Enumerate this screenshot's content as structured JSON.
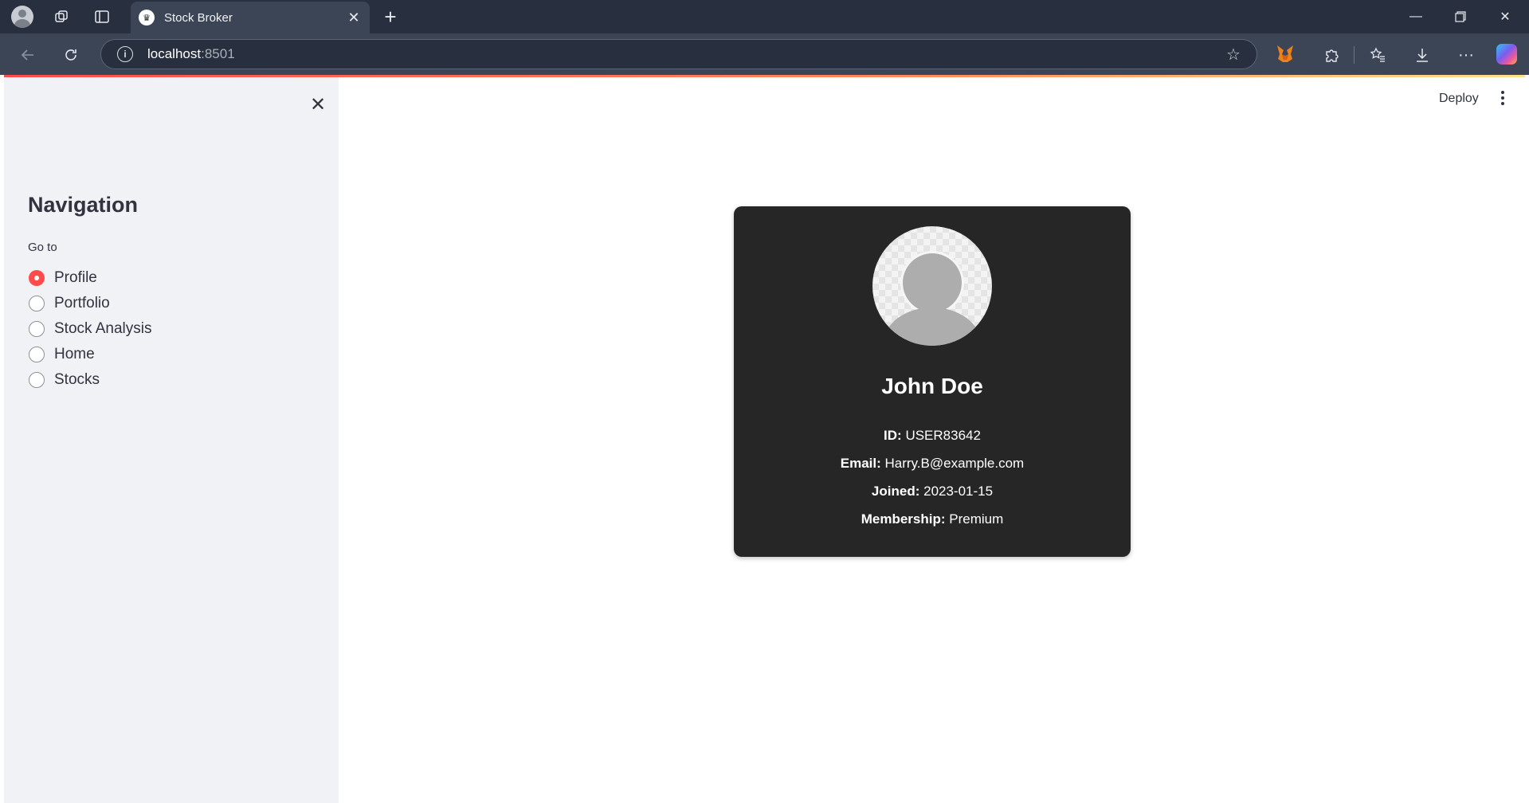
{
  "browser": {
    "tab_title": "Stock Broker",
    "url_host": "localhost",
    "url_port": ":8501"
  },
  "sidebar": {
    "title": "Navigation",
    "radio_label": "Go to",
    "options": [
      "Profile",
      "Portfolio",
      "Stock Analysis",
      "Home",
      "Stocks"
    ],
    "selected": "Profile"
  },
  "header": {
    "deploy_label": "Deploy"
  },
  "profile": {
    "name": "John Doe",
    "id_label": "ID:",
    "id_value": "USER83642",
    "email_label": "Email:",
    "email_value": "Harry.B@example.com",
    "joined_label": "Joined:",
    "joined_value": "2023-01-15",
    "membership_label": "Membership:",
    "membership_value": "Premium"
  },
  "colors": {
    "accent": "#ff4b4b",
    "card_bg": "#262626",
    "sidebar_bg": "#f0f2f6"
  }
}
